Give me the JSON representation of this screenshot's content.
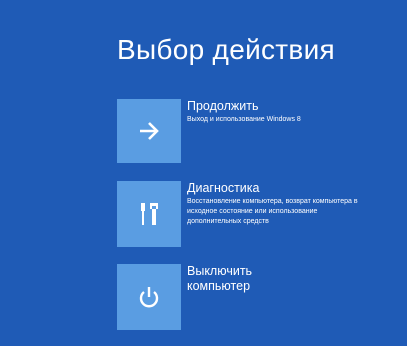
{
  "screen": {
    "title": "Выбор действия",
    "background_color": "#1f5bb6",
    "tile_color": "#5a9de2"
  },
  "options": [
    {
      "title": "Продолжить",
      "subtitle": "Выход и использование Windows 8",
      "icon": "arrow-right-icon"
    },
    {
      "title": "Диагностика",
      "subtitle": "Восстановление компьютера, возврат компьютера в исходное состояние или использование дополнительных средств",
      "icon": "tools-icon"
    },
    {
      "title": "Выключить компьютер",
      "subtitle": "",
      "icon": "power-icon"
    }
  ]
}
